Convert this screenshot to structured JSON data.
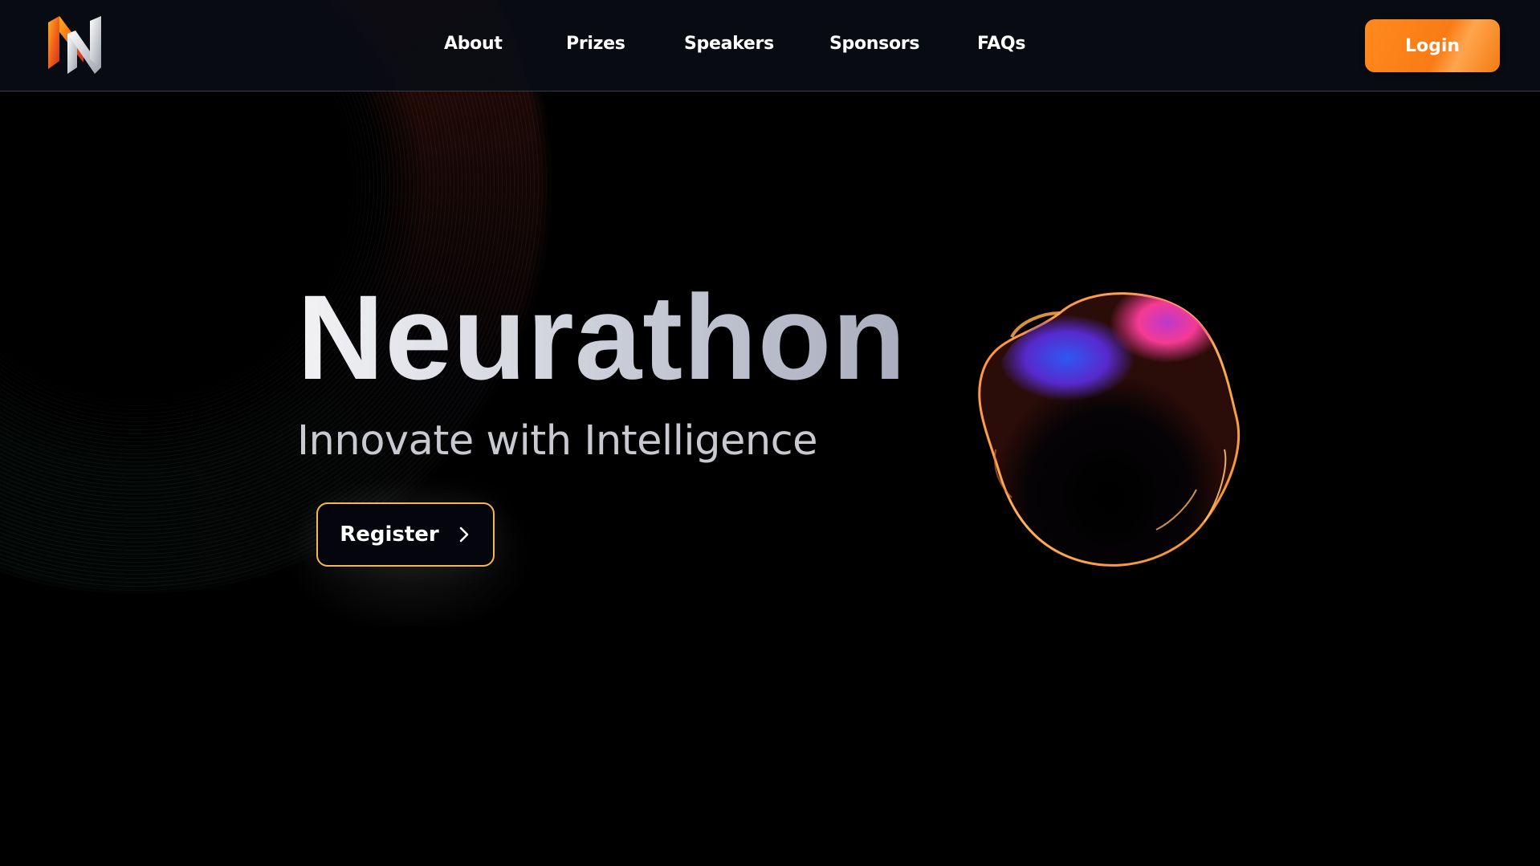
{
  "header": {
    "logo_icon": "neurathon-n-logo-icon",
    "nav": [
      {
        "label": "About"
      },
      {
        "label": "Prizes"
      },
      {
        "label": "Speakers"
      },
      {
        "label": "Sponsors"
      },
      {
        "label": "FAQs"
      }
    ],
    "login_label": "Login"
  },
  "hero": {
    "title": "Neurathon",
    "subtitle": "Innovate with Intelligence",
    "register_label": "Register",
    "register_icon": "chevron-right-icon",
    "blob_icon": "iridescent-blob-graphic"
  },
  "colors": {
    "accent": "#f97b15",
    "register_border": "#f5b84a",
    "background": "#000000"
  }
}
